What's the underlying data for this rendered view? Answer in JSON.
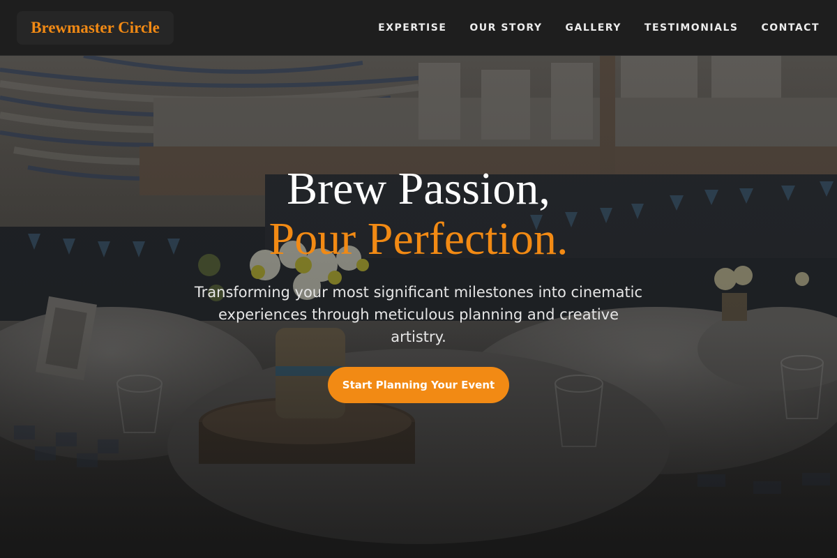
{
  "brand": {
    "name": "Brewmaster Circle",
    "accent": "#f28a14"
  },
  "nav": {
    "items": [
      {
        "label": "EXPERTISE"
      },
      {
        "label": "OUR STORY"
      },
      {
        "label": "GALLERY"
      },
      {
        "label": "TESTIMONIALS"
      },
      {
        "label": "CONTACT"
      }
    ]
  },
  "hero": {
    "title_line1": "Brew Passion,",
    "title_line2": "Pour Perfection.",
    "subtitle": "Transforming your most significant milestones into cinematic experiences through meticulous planning and creative artistry.",
    "cta_label": "Start Planning Your Event"
  }
}
